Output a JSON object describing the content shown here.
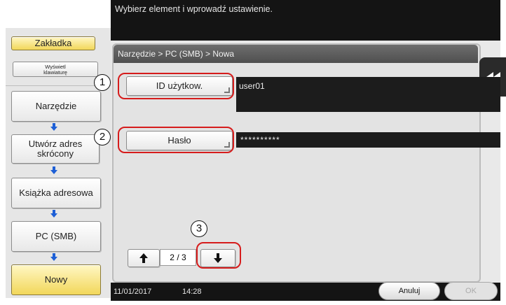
{
  "header": {
    "instruction": "Wybierz element i wprowadź ustawienie."
  },
  "left_panel": {
    "tab_label": "Zakładka",
    "keyboard_label": "Wyświetl klawiaturę",
    "steps": [
      {
        "label": "Narzędzie"
      },
      {
        "label": "Utwórz adres skrócony"
      },
      {
        "label": "Książka adresowa"
      },
      {
        "label": "PC (SMB)"
      },
      {
        "label": "Nowy"
      }
    ]
  },
  "main": {
    "breadcrumb": "Narzędzie > PC (SMB) > Nowa",
    "user_id_button": "ID użytkow.",
    "user_id_value": "user01",
    "password_button": "Hasło",
    "password_value": "**********",
    "pager": {
      "current": "2",
      "separator": "/",
      "total": "3"
    }
  },
  "callouts": [
    "1",
    "2",
    "3"
  ],
  "footer": {
    "date": "11/01/2017",
    "time": "14:28",
    "cancel_label": "Anuluj",
    "ok_label": "OK"
  },
  "colors": {
    "highlight_ring": "#d61c1c",
    "active_step": "#f2d75a",
    "arrow": "#1d5fd6"
  },
  "icons": [
    "arrow-up-icon",
    "arrow-down-icon",
    "collapse-double-arrow-icon",
    "step-arrow-down-icon"
  ]
}
